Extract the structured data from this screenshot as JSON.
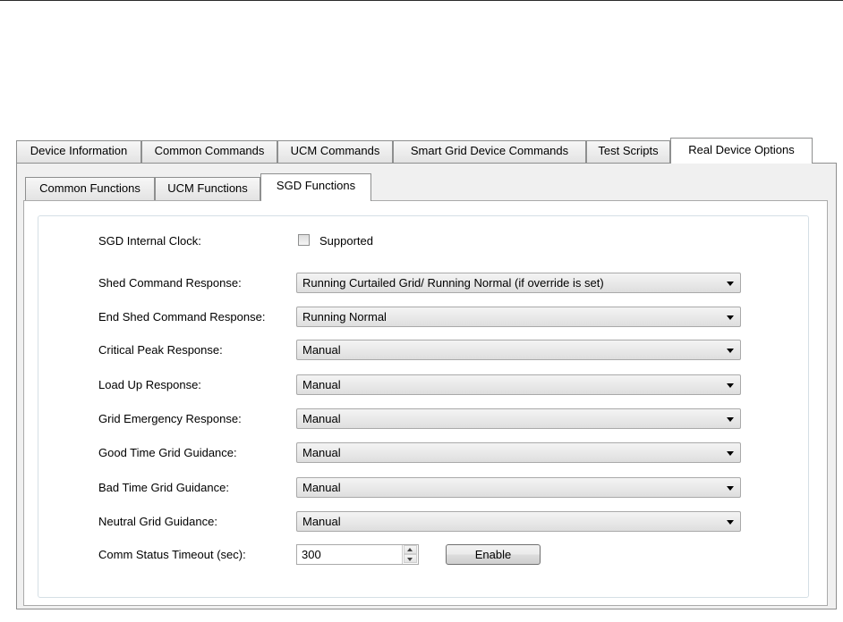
{
  "outer_tabs": [
    {
      "label": "Device Information",
      "active": false
    },
    {
      "label": "Common Commands",
      "active": false
    },
    {
      "label": "UCM Commands",
      "active": false
    },
    {
      "label": "Smart Grid Device Commands",
      "active": false
    },
    {
      "label": "Test Scripts",
      "active": false
    },
    {
      "label": "Real Device Options",
      "active": true
    }
  ],
  "inner_tabs": [
    {
      "label": "Common Functions",
      "active": false
    },
    {
      "label": "UCM Functions",
      "active": false
    },
    {
      "label": "SGD Functions",
      "active": true
    }
  ],
  "form": {
    "clock": {
      "label": "SGD Internal Clock:",
      "checkbox_label": "Supported",
      "checked": false
    },
    "fields": [
      {
        "label": "Shed Command Response:",
        "value": "Running Curtailed Grid/ Running Normal (if override is set)"
      },
      {
        "label": "End Shed Command Response:",
        "value": "Running Normal"
      },
      {
        "label": "Critical Peak Response:",
        "value": "Manual"
      },
      {
        "label": "Load Up Response:",
        "value": "Manual"
      },
      {
        "label": "Grid Emergency Response:",
        "value": "Manual"
      },
      {
        "label": "Good Time Grid Guidance:",
        "value": "Manual"
      },
      {
        "label": "Bad Time Grid Guidance:",
        "value": "Manual"
      },
      {
        "label": "Neutral Grid Guidance:",
        "value": "Manual"
      }
    ],
    "timeout": {
      "label": "Comm Status Timeout (sec):",
      "value": "300",
      "button": "Enable"
    }
  },
  "icons": {
    "dropdown": "chevron-down-icon",
    "spin_up": "spin-up-icon",
    "spin_down": "spin-down-icon"
  }
}
